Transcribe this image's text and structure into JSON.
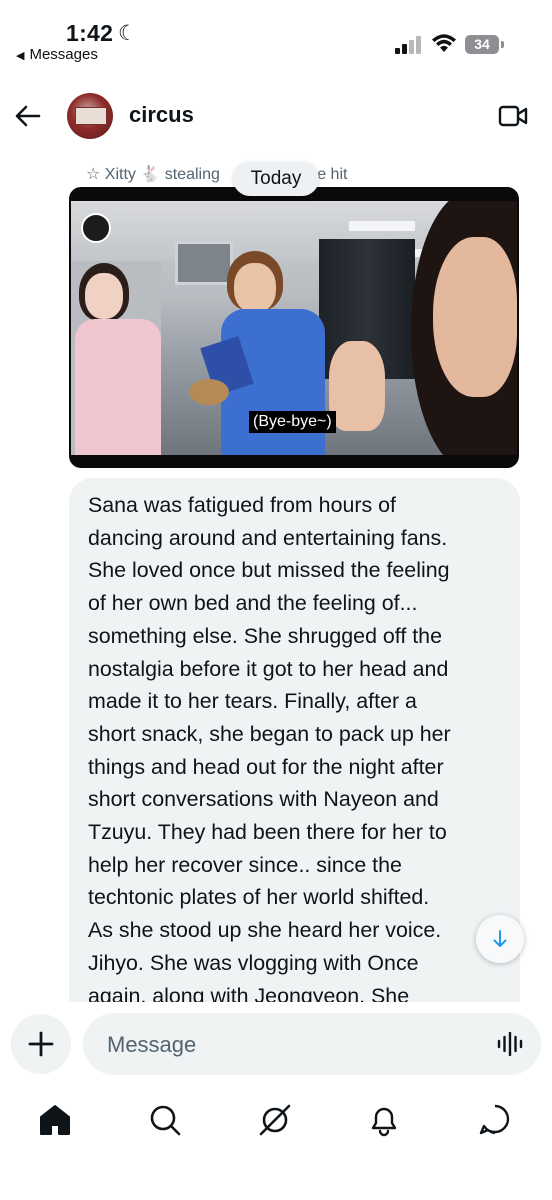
{
  "status_bar": {
    "time": "1:42",
    "back_app": "Messages",
    "battery": "34"
  },
  "header": {
    "title": "circus"
  },
  "chat": {
    "reply_preview": "☆ Xitty 🐇 stealing",
    "reply_preview_tail": "me hit",
    "date_divider": "Today",
    "media_subtitle": "(Bye-bye~)",
    "message_text": "Sana was fatigued from hours of\ndancing around and entertaining fans.\nShe loved once but missed the feeling\nof her own bed and the feeling of...\nsomething else. She shrugged off the\nnostalgia before it got to her head and\nmade it to her tears. Finally, after a\nshort snack, she began to pack up her\nthings and head out for the night after\nshort conversations with Nayeon and\nTzuyu. They had been there for her to\nhelp her recover since.. since the\ntechtonic plates of her world shifted.\nAs she stood up she heard her voice.\nJihyo. She was vlogging with Once\nagain, along with Jeongyeon. She"
  },
  "composer": {
    "placeholder": "Message"
  },
  "nav": {
    "items": [
      "home-icon",
      "search-icon",
      "grok-icon",
      "notifications-icon",
      "messages-icon"
    ]
  }
}
